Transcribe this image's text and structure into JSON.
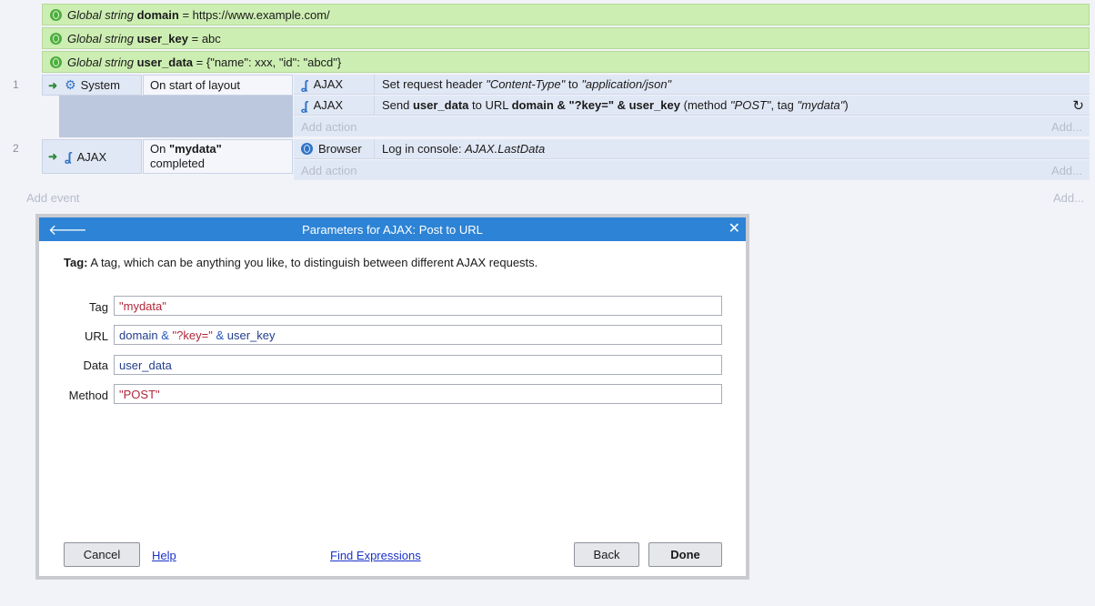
{
  "globals": [
    {
      "kind": "Global string",
      "name": "domain",
      "equals": " = ",
      "value": "https://www.example.com/"
    },
    {
      "kind": "Global string",
      "name": "user_key",
      "equals": " = ",
      "value": "abc"
    },
    {
      "kind": "Global string",
      "name": "user_data",
      "equals": " = ",
      "value": "{\"name\": xxx, \"id\": \"abcd\"}"
    }
  ],
  "events": [
    {
      "number": "1",
      "object": "System",
      "condition": "On start of layout",
      "actions": [
        {
          "object": "AJAX",
          "t1": "Set request header ",
          "t2": "\"Content-Type\"",
          "t3": " to ",
          "t4": "\"application/json\""
        },
        {
          "object": "AJAX",
          "t1": "Send ",
          "t2": "user_data",
          "t3": " to URL ",
          "t4": "domain & \"?key=\" & user_key",
          "t5": " (method ",
          "t6": "\"POST\"",
          "t7": ", tag ",
          "t8": "\"mydata\"",
          "t9": ")"
        }
      ],
      "add_action": "Add action",
      "add_more": "Add..."
    },
    {
      "number": "2",
      "object": "AJAX",
      "condition_pre": "On ",
      "condition_bold": "\"mydata\"",
      "condition_post": "completed",
      "actions": [
        {
          "object": "Browser",
          "t1": "Log in console: ",
          "t2": "AJAX.LastData"
        }
      ],
      "add_action": "Add action",
      "add_more": "Add..."
    }
  ],
  "add_event": "Add event",
  "add_event_more": "Add...",
  "dialog": {
    "title": "Parameters for AJAX: Post to URL",
    "desc_label": "Tag:",
    "desc_text": " A tag, which can be anything you like, to distinguish between different AJAX requests.",
    "fields": {
      "tag": {
        "label": "Tag",
        "value": "\"mydata\""
      },
      "url": {
        "label": "URL",
        "v1": "domain",
        "v2": " & ",
        "v3": "\"?key=\"",
        "v4": " & ",
        "v5": "user_key"
      },
      "data": {
        "label": "Data",
        "value": "user_data"
      },
      "method": {
        "label": "Method",
        "value": "\"POST\""
      }
    },
    "buttons": {
      "cancel": "Cancel",
      "help": "Help",
      "find": "Find Expressions",
      "back": "Back",
      "done": "Done"
    }
  },
  "icons": {
    "globe": "globe-icon",
    "gear": "gear-icon",
    "ajax": "ajax-icon",
    "arrow": "arrow-right-icon",
    "refresh": "refresh-icon",
    "back": "arrow-left-icon",
    "close": "close-icon"
  },
  "colors": {
    "globals_bg": "#cdeeb3",
    "event_bg": "#e1e8f5",
    "dialog_title": "#2d83d5",
    "string": "#b0263a"
  }
}
